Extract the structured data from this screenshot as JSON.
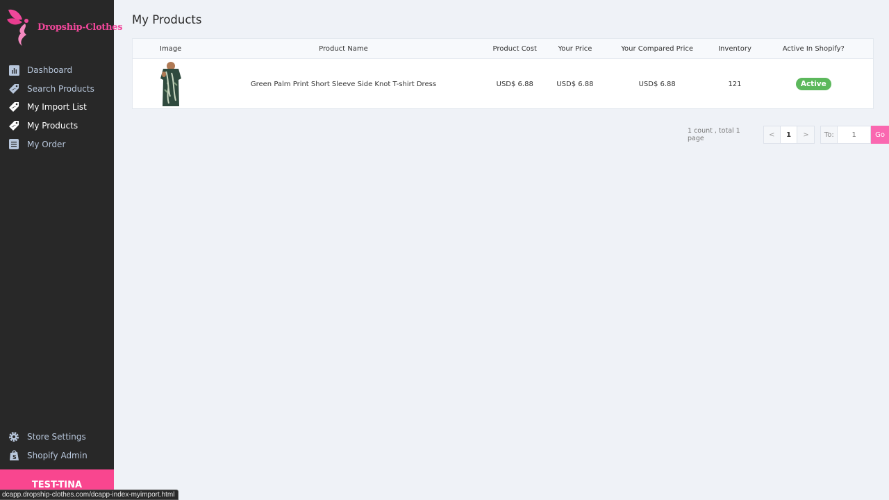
{
  "brand": {
    "name": "Dropship-Clothes",
    "accent": "#f0479a"
  },
  "sidebar": {
    "items": [
      {
        "label": "Dashboard",
        "icon": "bar-chart-icon"
      },
      {
        "label": "Search Products",
        "icon": "tag-icon"
      },
      {
        "label": "My Import List",
        "icon": "tag-icon"
      },
      {
        "label": "My Products",
        "icon": "tag-icon"
      },
      {
        "label": "My Order",
        "icon": "document-icon"
      }
    ],
    "bottom_items": [
      {
        "label": "Store Settings",
        "icon": "gear-icon"
      },
      {
        "label": "Shopify Admin",
        "icon": "shopify-bag-icon"
      }
    ],
    "user": "TEST-TINA"
  },
  "status_url": "dcapp.dropship-clothes.com/dcapp-index-myimport.html",
  "main": {
    "title": "My Products",
    "table": {
      "columns": [
        "Image",
        "Product Name",
        "Product Cost",
        "Your Price",
        "Your Compared Price",
        "Inventory",
        "Active In Shopify?"
      ],
      "rows": [
        {
          "image_alt": "Green palm print dress product photo",
          "name": "Green Palm Print Short Sleeve Side Knot T-shirt Dress",
          "cost": "USD$ 6.88",
          "price": "USD$ 6.88",
          "compared_price": "USD$ 6.88",
          "inventory": "121",
          "status": "Active"
        }
      ]
    },
    "pagination": {
      "info": "1 count , total 1 page",
      "prev": "<",
      "current": "1",
      "next": ">",
      "to_label": "To:",
      "to_value": "1",
      "go_label": "Go"
    }
  }
}
